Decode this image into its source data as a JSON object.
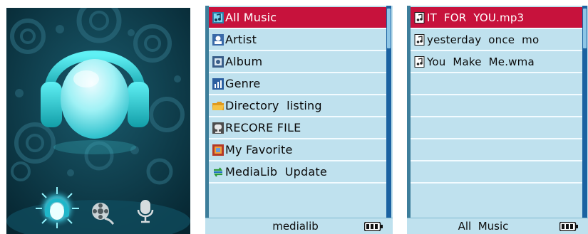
{
  "home_screen": {
    "menu_icons": [
      {
        "name": "music-icon",
        "selected": true
      },
      {
        "name": "movie-icon",
        "selected": false
      },
      {
        "name": "microphone-icon",
        "selected": false
      }
    ],
    "colors": {
      "background": "#0a3444",
      "accent": "#39d1dd"
    }
  },
  "medialib_screen": {
    "items": [
      {
        "label": "All Music",
        "icon": "music-library-icon",
        "selected": true
      },
      {
        "label": "Artist",
        "icon": "artist-icon",
        "selected": false
      },
      {
        "label": "Album",
        "icon": "album-icon",
        "selected": false
      },
      {
        "label": "Genre",
        "icon": "genre-icon",
        "selected": false
      },
      {
        "label": "Directory  listing",
        "icon": "folder-icon",
        "selected": false
      },
      {
        "label": "RECORE FILE",
        "icon": "record-icon",
        "selected": false
      },
      {
        "label": "My Favorite",
        "icon": "favorite-icon",
        "selected": false
      },
      {
        "label": "MediaLib  Update",
        "icon": "update-icon",
        "selected": false
      }
    ],
    "status": "medialib",
    "battery_icon": "battery-icon"
  },
  "allmusic_screen": {
    "tracks": [
      {
        "label": "IT  FOR  YOU.mp3",
        "icon": "music-file-icon",
        "selected": true
      },
      {
        "label": "yesterday  once  mo",
        "icon": "music-file-icon",
        "selected": false
      },
      {
        "label": "You  Make  Me.wma",
        "icon": "music-file-icon",
        "selected": false
      }
    ],
    "empty_rows": 5,
    "status": "All  Music",
    "battery_icon": "battery-icon"
  },
  "colors": {
    "list_background": "#bfe1ee",
    "selection": "#c7123c",
    "scrollbar": "#1b62a1",
    "frame": "#3d7e9b"
  }
}
